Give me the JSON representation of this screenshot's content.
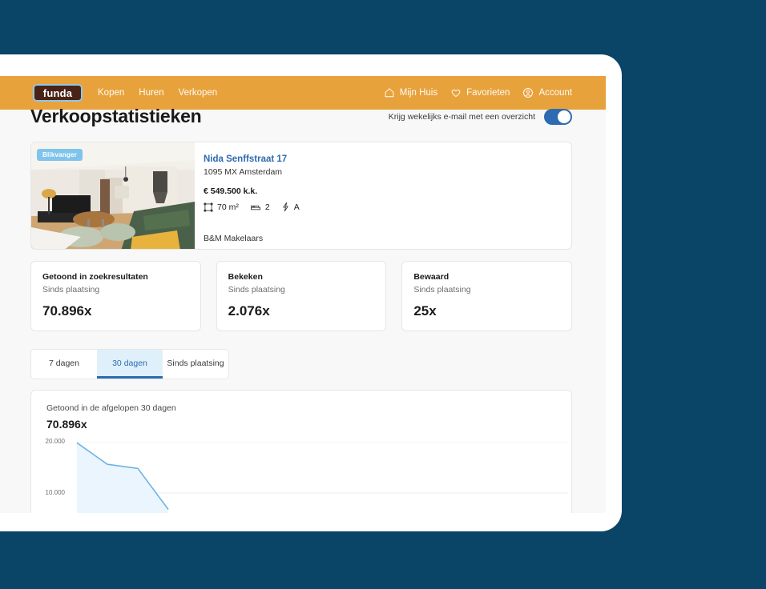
{
  "brand": {
    "logo_text": "funda",
    "orange": "#E8A23C",
    "blue": "#2E6BB0",
    "navy_background": "#0A4467"
  },
  "navbar": {
    "links": [
      {
        "label": "Kopen"
      },
      {
        "label": "Huren"
      },
      {
        "label": "Verkopen"
      }
    ],
    "account_items": [
      {
        "label": "Mijn Huis",
        "icon": "home-icon"
      },
      {
        "label": "Favorieten",
        "icon": "heart-icon"
      },
      {
        "label": "Account",
        "icon": "account-circle-icon"
      }
    ]
  },
  "page": {
    "title": "Verkoopstatistieken",
    "email_toggle": {
      "label": "Krijg wekelijks e-mail met een overzicht",
      "state": "on"
    }
  },
  "listing": {
    "badge": "Blikvanger",
    "title": "Nida Senffstraat 17",
    "address": "1095 MX Amsterdam",
    "price": "€ 549.500 k.k.",
    "features": [
      {
        "icon": "floor-area-icon",
        "value": "70 m²"
      },
      {
        "icon": "bed-icon",
        "value": "2"
      },
      {
        "icon": "energy-label-icon",
        "value": "A"
      }
    ],
    "agent": "B&M Makelaars"
  },
  "stats": [
    {
      "title": "Getoond in zoekresultaten",
      "subtitle": "Sinds plaatsing",
      "value": "70.896x"
    },
    {
      "title": "Bekeken",
      "subtitle": "Sinds plaatsing",
      "value": "2.076x"
    },
    {
      "title": "Bewaard",
      "subtitle": "Sinds plaatsing",
      "value": "25x"
    }
  ],
  "tabs": [
    {
      "label": "7 dagen",
      "active": false
    },
    {
      "label": "30 dagen",
      "active": true
    },
    {
      "label": "Sinds plaatsing",
      "active": false
    }
  ],
  "chart_panel": {
    "caption": "Getoond in de afgelopen 30 dagen",
    "total": "70.896x"
  },
  "chart_data": {
    "type": "area",
    "title": "Getoond in de afgelopen 30 dagen",
    "xlabel": "",
    "ylabel": "",
    "ylim": [
      0,
      22000
    ],
    "grid": true,
    "legend": "none",
    "line_color": "#6CB4E4",
    "fill_color": "#EAF5FD",
    "ticks": [
      {
        "label": "20.000",
        "value": 20000
      },
      {
        "label": "10.000",
        "value": 10000
      }
    ],
    "x": [
      1,
      2,
      3,
      4
    ],
    "values": [
      19800,
      15600,
      14800,
      6800
    ],
    "note": "Visible portion of a 30-day series; the card clips the lower part of the plot."
  }
}
